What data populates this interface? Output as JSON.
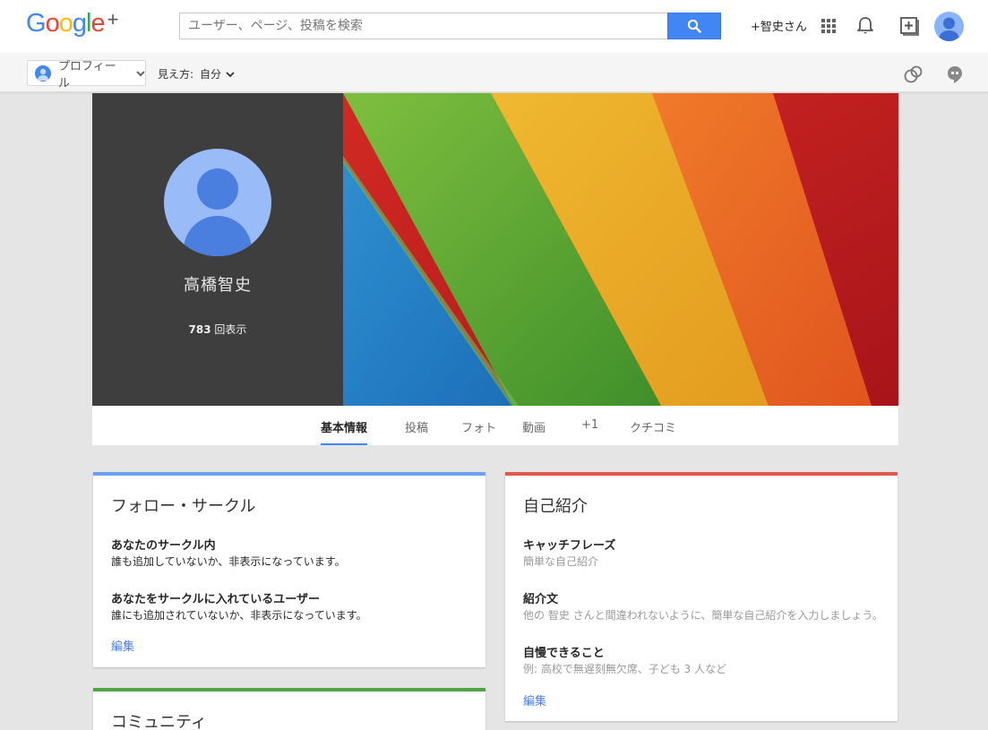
{
  "brand": {
    "logo_letters": [
      "G",
      "o",
      "o",
      "g",
      "l",
      "e"
    ],
    "logo_plus": "+",
    "colors": [
      "#4285f4",
      "#ea4335",
      "#fbbc05",
      "#4285f4",
      "#34a853",
      "#ea4335"
    ]
  },
  "search": {
    "placeholder": "ユーザー、ページ、投稿を検索",
    "icon": "search-icon"
  },
  "header": {
    "user_link": "+智史さん",
    "icons": [
      "apps-grid-icon",
      "notification-bell-icon",
      "share-plus-icon",
      "account-avatar"
    ]
  },
  "subbar": {
    "profile_label": "プロフィール",
    "view_as_label": "見え方:",
    "view_as_value": "自分",
    "icons": [
      "circles-icon",
      "hangouts-icon"
    ]
  },
  "profile": {
    "name": "高橋智史",
    "views_count": "783",
    "views_suffix": " 回表示"
  },
  "tabs": [
    {
      "label": "基本情報",
      "active": true
    },
    {
      "label": "投稿",
      "active": false
    },
    {
      "label": "フォト",
      "active": false
    },
    {
      "label": "動画",
      "active": false
    },
    {
      "label": "+1",
      "active": false
    },
    {
      "label": "クチコミ",
      "active": false
    }
  ],
  "cards": {
    "follow": {
      "title": "フォロー・サークル",
      "accent": "#6ea0f2",
      "section1_label": "あなたのサークル内",
      "section1_text": "誰も追加していないか、非表示になっています。",
      "section2_label": "あなたをサークルに入れているユーザー",
      "section2_text": "誰にも追加されていないか、非表示になっています。",
      "edit": "編集"
    },
    "about": {
      "title": "自己紹介",
      "accent": "#dd5a4c",
      "catchphrase_label": "キャッチフレーズ",
      "catchphrase_text": "簡単な自己紹介",
      "intro_label": "紹介文",
      "intro_text": "他の 智史 さんと間違われないように、簡単な自己紹介を入力しましょう。",
      "brag_label": "自慢できること",
      "brag_text": "例: 高校で無遅刻無欠席、子ども 3 人など",
      "edit": "編集"
    },
    "community": {
      "title": "コミュニティ",
      "accent": "#52a348"
    }
  }
}
